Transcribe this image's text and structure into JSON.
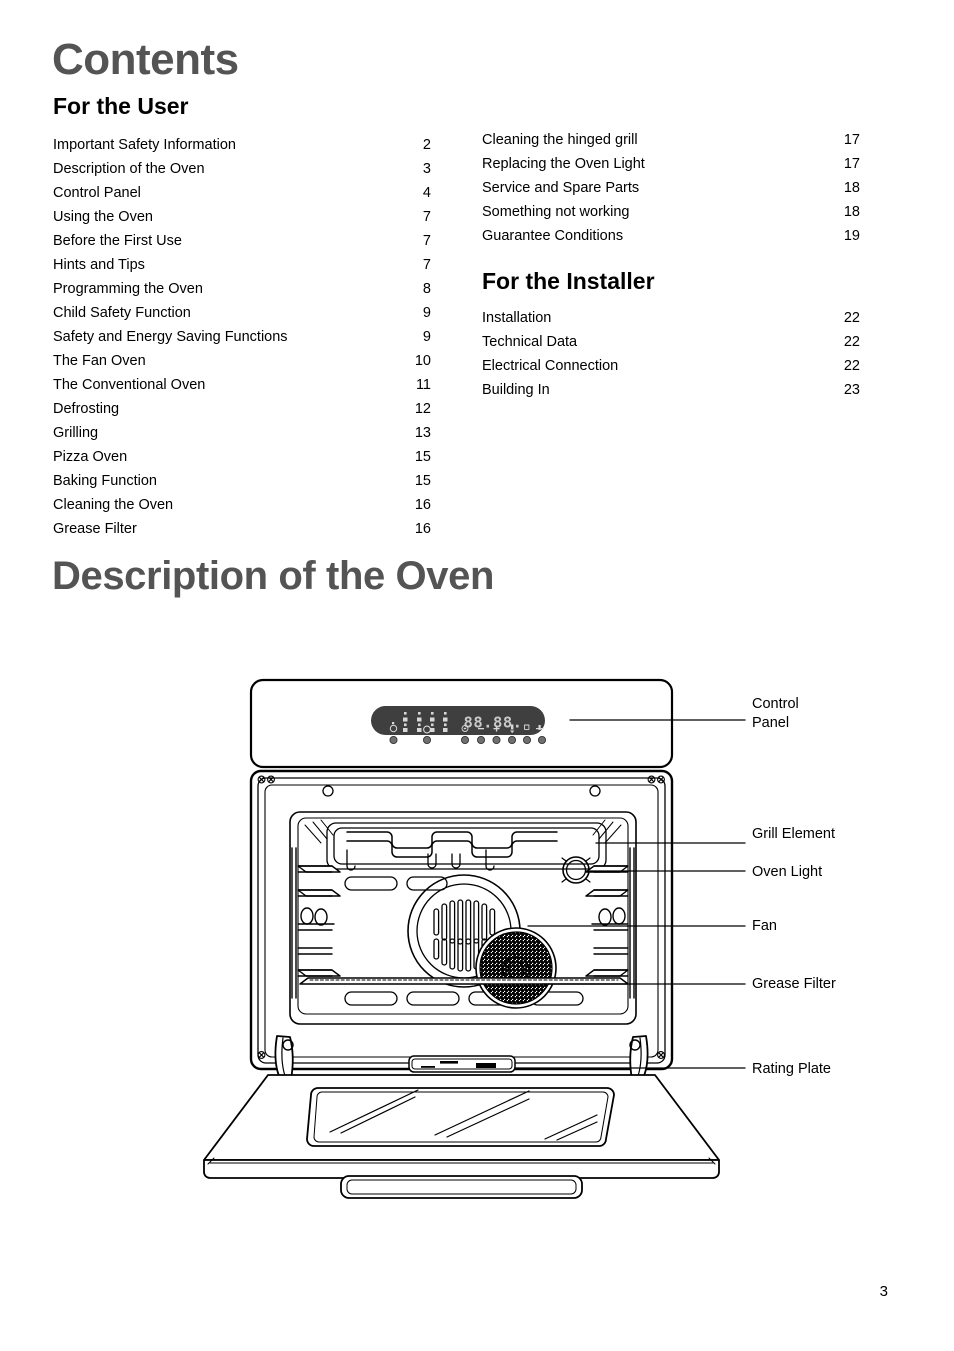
{
  "document": {
    "page_number": "3"
  },
  "contents": {
    "title": "Contents",
    "user_heading": "For the User",
    "installer_heading": "For the Installer",
    "user_entries_left": [
      {
        "title": "Important Safety Information",
        "page": "2"
      },
      {
        "title": "Description of the Oven",
        "page": "3"
      },
      {
        "title": "Control Panel",
        "page": "4"
      },
      {
        "title": "Using the Oven",
        "page": "7"
      },
      {
        "title": "Before the First Use",
        "page": "7"
      },
      {
        "title": "Hints and Tips",
        "page": "7"
      },
      {
        "title": "Programming the Oven",
        "page": "8"
      },
      {
        "title": "Child Safety Function",
        "page": "9"
      },
      {
        "title": "Safety and Energy Saving Functions",
        "page": "9"
      },
      {
        "title": "The Fan Oven",
        "page": "10"
      },
      {
        "title": "The Conventional Oven",
        "page": "11"
      },
      {
        "title": "Defrosting",
        "page": "12"
      },
      {
        "title": "Grilling",
        "page": "13"
      },
      {
        "title": "Pizza Oven",
        "page": "15"
      },
      {
        "title": "Baking Function",
        "page": "15"
      },
      {
        "title": "Cleaning the Oven",
        "page": "16"
      },
      {
        "title": "Grease Filter",
        "page": "16"
      }
    ],
    "user_entries_right": [
      {
        "title": "Cleaning the hinged grill",
        "page": "17"
      },
      {
        "title": "Replacing the Oven Light",
        "page": "17"
      },
      {
        "title": "Service and Spare Parts",
        "page": "18"
      },
      {
        "title": "Something not working",
        "page": "18"
      },
      {
        "title": "Guarantee Conditions",
        "page": "19"
      }
    ],
    "installer_entries": [
      {
        "title": "Installation",
        "page": "22"
      },
      {
        "title": "Technical Data",
        "page": "22"
      },
      {
        "title": "Electrical Connection",
        "page": "22"
      },
      {
        "title": "Building In",
        "page": "23"
      }
    ]
  },
  "description_section": {
    "title": "Description of the Oven",
    "callouts": [
      {
        "id": "control-panel",
        "label": "Control\nPanel"
      },
      {
        "id": "grill-element",
        "label": "Grill Element"
      },
      {
        "id": "oven-light",
        "label": "Oven Light"
      },
      {
        "id": "fan",
        "label": "Fan"
      },
      {
        "id": "grease-filter",
        "label": "Grease Filter"
      },
      {
        "id": "rating-plate",
        "label": "Rating Plate"
      }
    ],
    "control_panel": {
      "display_value": "88.88.",
      "display_color": "#c9c9c9",
      "panel_color": "#3f3f3f"
    }
  },
  "colors": {
    "heading_gray": "#545454",
    "body_black": "#000000",
    "page_background": "#ffffff",
    "line_stroke": "#000000"
  }
}
